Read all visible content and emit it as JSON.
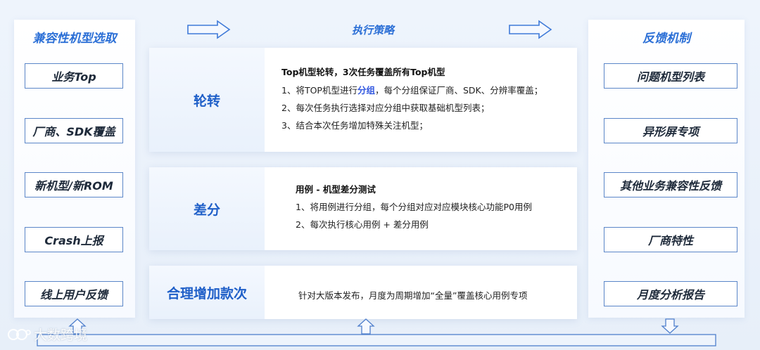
{
  "left_column": {
    "title": "兼容性机型选取",
    "items": [
      "业务Top",
      "厂商、SDK覆盖",
      "新机型/新ROM",
      "Crash上报",
      "线上用户反馈"
    ]
  },
  "center": {
    "title": "执行策略",
    "cards": [
      {
        "label": "轮转",
        "heading": "Top机型轮转，3次任务覆盖所有Top机型",
        "line1_pre": "1、将TOP机型进行",
        "line1_hl": "分组",
        "line1_post": "，每个分组保证厂商、SDK、分辨率覆盖；",
        "line2": "2、每次任务执行选择对应分组中获取基础机型列表；",
        "line3": "3、结合本次任务增加特殊关注机型；"
      },
      {
        "label": "差分",
        "heading": "用例 - 机型差分测试",
        "line1": "1、将用例进行分组，每个分组对应对应模块核心功能P0用例",
        "line2": "2、每次执行核心用例 + 差分用例"
      },
      {
        "label": "合理增加款次",
        "text": "针对大版本发布，月度为周期增加“全量”覆盖核心用例专项"
      }
    ]
  },
  "right_column": {
    "title": "反馈机制",
    "items": [
      "问题机型列表",
      "异形屏专项",
      "其他业务兼容性反馈",
      "厂商特性",
      "月度分析报告"
    ]
  },
  "watermark": "大数跨境",
  "colors": {
    "accent": "#2b6fd6",
    "label_blue": "#1f5fc8",
    "box_border": "#5b86c8",
    "highlight": "#3157e0"
  }
}
